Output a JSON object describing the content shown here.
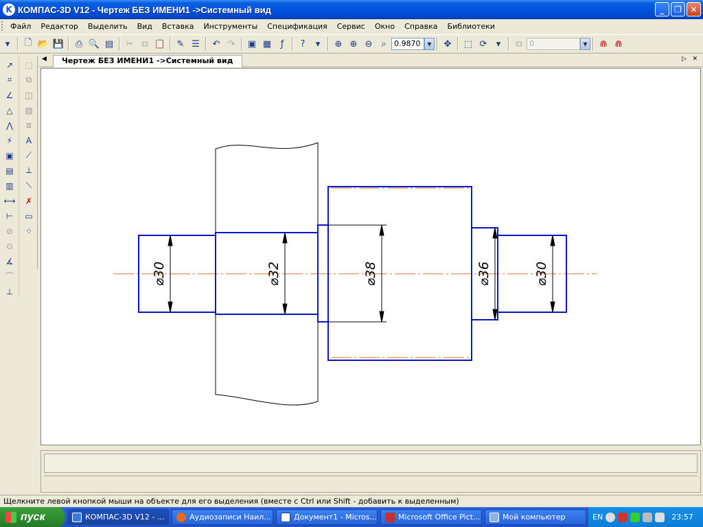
{
  "window": {
    "title": "КОМПАС-3D V12 - Чертеж БЕЗ ИМЕНИ1 ->Системный вид",
    "icon": "K"
  },
  "menu": {
    "items": [
      {
        "label": "Файл"
      },
      {
        "label": "Редактор"
      },
      {
        "label": "Выделить"
      },
      {
        "label": "Вид"
      },
      {
        "label": "Вставка"
      },
      {
        "label": "Инструменты"
      },
      {
        "label": "Спецификация"
      },
      {
        "label": "Сервис"
      },
      {
        "label": "Окно"
      },
      {
        "label": "Справка"
      },
      {
        "label": "Библиотеки"
      }
    ]
  },
  "toolbar": {
    "zoom_value": "0.9870",
    "layer_value": "0"
  },
  "document": {
    "tab_label": "Чертеж БЕЗ ИМЕНИ1 ->Системный вид"
  },
  "drawing": {
    "dimensions": [
      "⌀30",
      "⌀32",
      "⌀38",
      "⌀36",
      "⌀30"
    ],
    "colors": {
      "contour": "#0a14c8",
      "outline": "#000000",
      "axis": "#e07020"
    }
  },
  "statusbar": {
    "hint": "Щелкните левой кнопкой мыши на объекте для его выделения (вместе с Ctrl или Shift - добавить к выделенным)"
  },
  "taskbar": {
    "start_label": "пуск",
    "tasks": [
      {
        "label": "КОМПАС-3D V12 - ...",
        "icon": "kompas-icon"
      },
      {
        "label": "Аудиозаписи Наил...",
        "icon": "firefox-icon"
      },
      {
        "label": "Документ1 - Micros...",
        "icon": "word-icon"
      },
      {
        "label": "Microsoft Office Pict...",
        "icon": "picture-manager-icon"
      },
      {
        "label": "Мой компьютер",
        "icon": "my-computer-icon"
      }
    ],
    "tray": {
      "lang": "EN",
      "time": "23:57"
    }
  }
}
